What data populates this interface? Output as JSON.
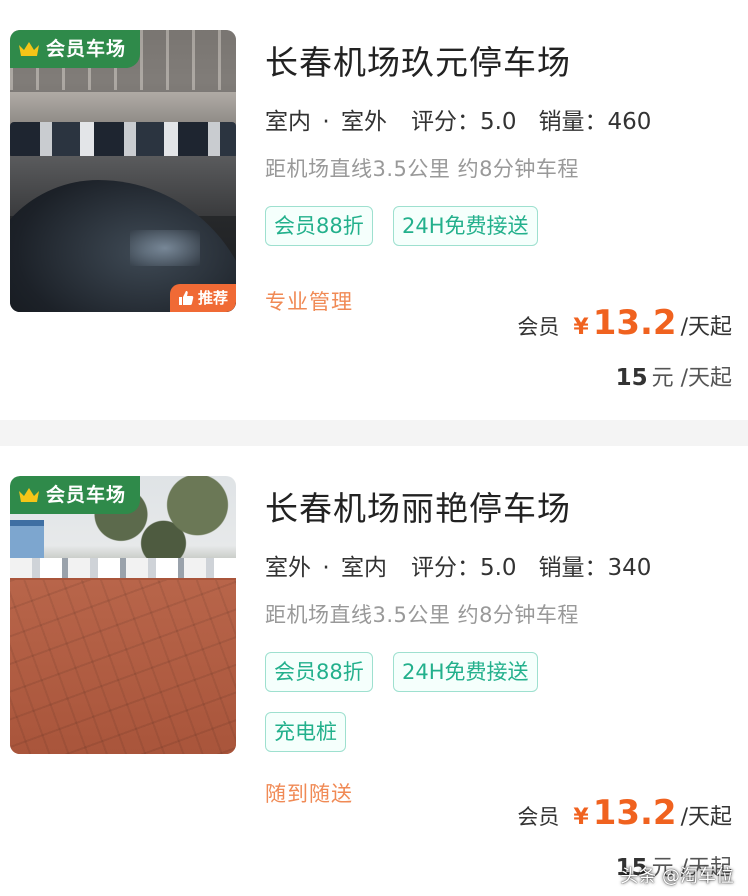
{
  "listings": [
    {
      "badge": "会员车场",
      "recommend": "推荐",
      "title": "长春机场玖元停车场",
      "location_a": "室内",
      "location_sep": "·",
      "location_b": "室外",
      "rating_label": "评分：",
      "rating": "5.0",
      "sales_label": "销量：",
      "sales": "460",
      "distance": "距机场直线3.5公里 约8分钟车程",
      "tags": [
        "会员88折",
        "24H免费接送"
      ],
      "feature": "专业管理",
      "member_label": "会员",
      "currency": "¥",
      "member_price": "13.2",
      "price_unit": "/天起",
      "original_price": "15",
      "original_unit": "元 /天起"
    },
    {
      "badge": "会员车场",
      "title": "长春机场丽艳停车场",
      "location_a": "室外",
      "location_sep": "·",
      "location_b": "室内",
      "rating_label": "评分：",
      "rating": "5.0",
      "sales_label": "销量：",
      "sales": "340",
      "distance": "距机场直线3.5公里 约8分钟车程",
      "tags": [
        "会员88折",
        "24H免费接送",
        "充电桩"
      ],
      "feature": "随到随送",
      "member_label": "会员",
      "currency": "¥",
      "member_price": "13.2",
      "price_unit": "/天起",
      "original_price": "15",
      "original_unit": "元 /天起"
    }
  ],
  "watermark": "头条 @淘车位",
  "colors": {
    "accent_orange": "#f0621f",
    "tag_green": "#23b08c",
    "badge_green": "#2f8a4a",
    "feature_orange": "#f08a55"
  },
  "icons": [
    "crown-icon",
    "thumbs-up-icon"
  ]
}
